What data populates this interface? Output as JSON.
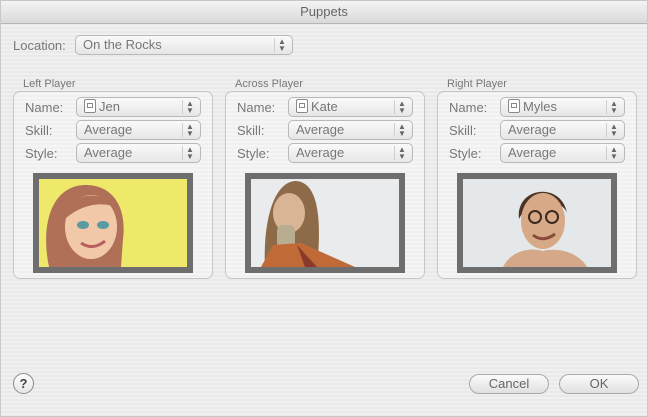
{
  "window": {
    "title": "Puppets"
  },
  "location": {
    "label": "Location:",
    "value": "On the Rocks"
  },
  "field_labels": {
    "name": "Name:",
    "skill": "Skill:",
    "style": "Style:"
  },
  "players": [
    {
      "group_title": "Left Player",
      "name": "Jen",
      "skill": "Average",
      "style": "Average",
      "avatar": "cartoon-woman-portrait"
    },
    {
      "group_title": "Across Player",
      "name": "Kate",
      "skill": "Average",
      "style": "Average",
      "avatar": "woman-photo-portrait"
    },
    {
      "group_title": "Right Player",
      "name": "Myles",
      "skill": "Average",
      "style": "Average",
      "avatar": "man-photo-portrait"
    }
  ],
  "buttons": {
    "help": "?",
    "cancel": "Cancel",
    "ok": "OK"
  },
  "icons": {
    "user": "user-icon",
    "popup_arrows": "updown-arrows-icon",
    "help": "help-icon"
  }
}
